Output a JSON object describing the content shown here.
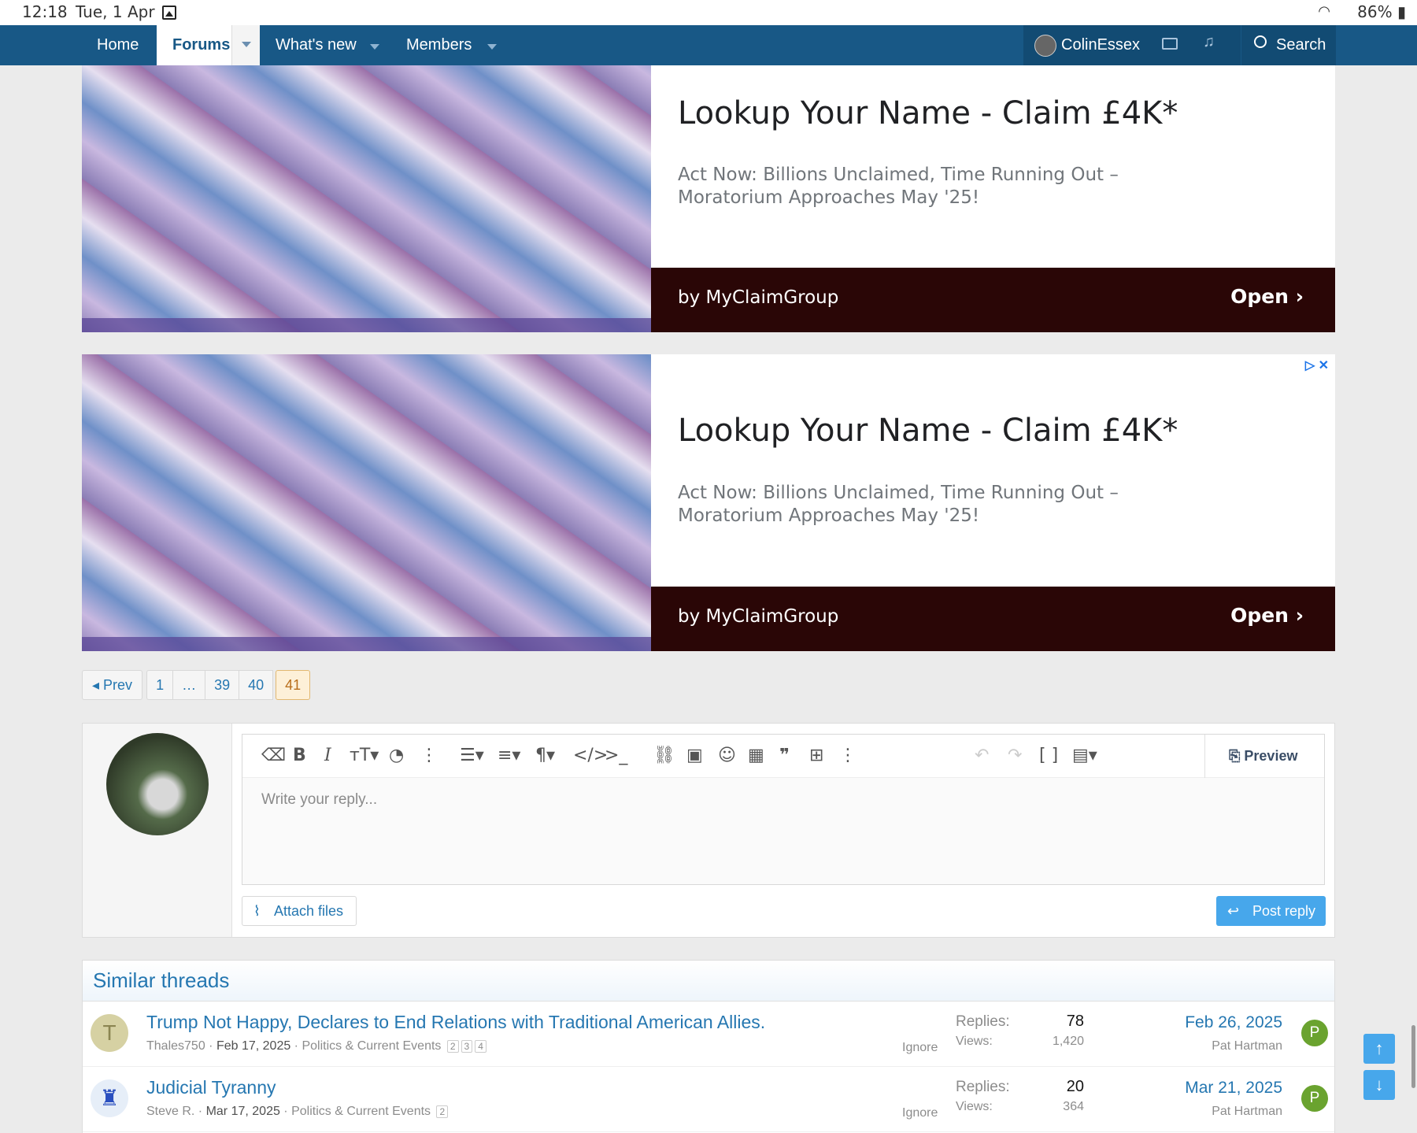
{
  "status_bar": {
    "time": "12:18",
    "date": "Tue, 1 Apr",
    "battery": "86%"
  },
  "nav": {
    "home": "Home",
    "forums": "Forums",
    "whats_new": "What's new",
    "members": "Members",
    "username": "ColinEssex",
    "search": "Search"
  },
  "ads": [
    {
      "title": "Lookup Your Name - Claim £4K*",
      "description": "Act Now: Billions Unclaimed, Time Running Out – Moratorium Approaches May '25!",
      "advertiser": "by MyClaimGroup",
      "cta": "Open"
    },
    {
      "title": "Lookup Your Name - Claim £4K*",
      "description": "Act Now: Billions Unclaimed, Time Running Out – Moratorium Approaches May '25!",
      "advertiser": "by MyClaimGroup",
      "cta": "Open"
    }
  ],
  "pagination": {
    "prev": "Prev",
    "pages": [
      "1",
      "…",
      "39",
      "40"
    ],
    "current": "41"
  },
  "reply": {
    "placeholder": "Write your reply...",
    "preview": "Preview",
    "attach": "Attach files",
    "post": "Post reply"
  },
  "similar": {
    "heading": "Similar threads",
    "threads": [
      {
        "avatar_letter": "T",
        "title": "Trump Not Happy, Declares to End Relations with Traditional American Allies.",
        "author": "Thales750",
        "date": "Feb 17, 2025",
        "forum": "Politics & Current Events",
        "pages": [
          "2",
          "3",
          "4"
        ],
        "ignore": "Ignore",
        "replies_label": "Replies:",
        "replies": "78",
        "views_label": "Views:",
        "views": "1,420",
        "last_date": "Feb 26, 2025",
        "last_user": "Pat Hartman",
        "last_avatar": "P"
      },
      {
        "avatar_letter": "",
        "title": "Judicial Tyranny",
        "author": "Steve R.",
        "date": "Mar 17, 2025",
        "forum": "Politics & Current Events",
        "pages": [
          "2"
        ],
        "ignore": "Ignore",
        "replies_label": "Replies:",
        "replies": "20",
        "views_label": "Views:",
        "views": "364",
        "last_date": "Mar 21, 2025",
        "last_user": "Pat Hartman",
        "last_avatar": "P"
      }
    ]
  },
  "colors": {
    "nav_bg": "#185886",
    "link": "#2577b1",
    "ad_bar": "#2a0606",
    "button": "#47a7eb",
    "current_page": "#b86d1a"
  }
}
